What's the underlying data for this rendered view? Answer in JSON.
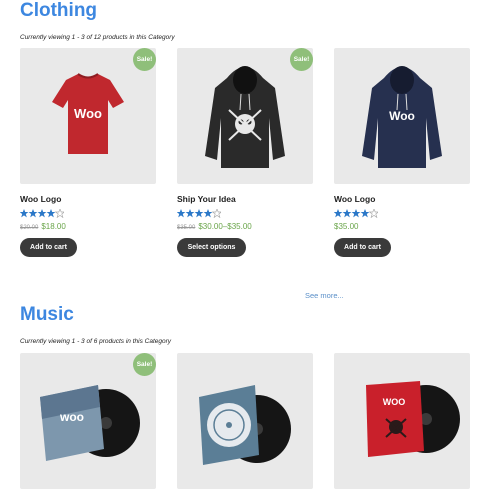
{
  "sections": [
    {
      "title": "Clothing",
      "viewing": "Currently viewing 1 - 3 of 12 products in this Category",
      "products": [
        {
          "name": "Woo Logo",
          "rating": 4,
          "rating_max": 5,
          "old_price": "$20.00",
          "price": "$18.00",
          "button": "Add to cart",
          "sale": "Sale!"
        },
        {
          "name": "Ship Your Idea",
          "rating": 4,
          "rating_max": 5,
          "old_price": "$35.00",
          "price": "$30.00–$35.00",
          "button": "Select options",
          "sale": "Sale!"
        },
        {
          "name": "Woo Logo",
          "rating": 4,
          "rating_max": 5,
          "old_price": "",
          "price": "$35.00",
          "button": "Add to cart",
          "sale": ""
        }
      ],
      "see_more": "See more..."
    },
    {
      "title": "Music",
      "viewing": "Currently viewing 1 - 3 of 6 products in this Category",
      "products": [
        {
          "sale": "Sale!"
        },
        {
          "sale": ""
        },
        {
          "sale": ""
        }
      ]
    }
  ],
  "colors": {
    "accent": "#3d87e0",
    "sale_badge": "#8fbf7a",
    "price": "#6aa54a",
    "star": "#2b78c8",
    "button": "#3a3a3a"
  },
  "icons": [
    "red-tshirt-woo-image",
    "black-hoodie-skull-image",
    "navy-hoodie-woo-image",
    "woo-album-image",
    "woothemes-album-image",
    "woo-ninja-album-image"
  ]
}
